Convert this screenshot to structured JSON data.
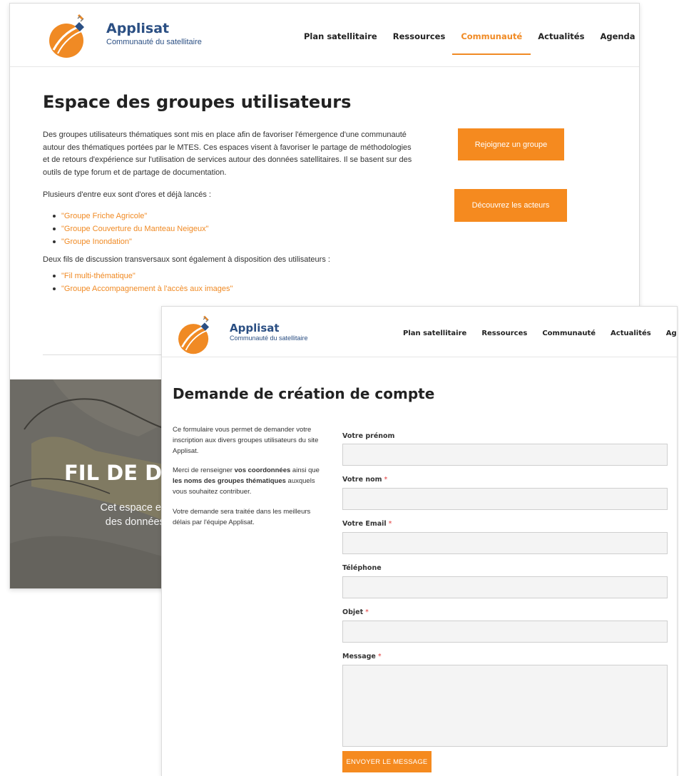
{
  "colors": {
    "accent": "#f08a24",
    "brand": "#2b4f83",
    "button": "#f58a1f",
    "required": "#e23a3a",
    "field_bg": "#f4f4f4",
    "hero_bg": "#6d6b65"
  },
  "site": {
    "name": "Applisat",
    "tagline": "Communauté du satellitaire"
  },
  "nav": {
    "items": [
      "Plan satellitaire",
      "Ressources",
      "Communauté",
      "Actualités",
      "Agenda"
    ],
    "active": "Communauté"
  },
  "groups_page": {
    "title": "Espace des groupes utilisateurs",
    "intro": "Des groupes utilisateurs thématiques sont mis en place afin de favoriser l'émergence d'une communauté autour des thématiques portées par le MTES. Ces espaces visent à favoriser le partage de méthodologies et de retours d'expérience sur l'utilisation de services autour des données satellitaires. Il se basent sur des outils de type forum et de partage de documentation.",
    "launched_text": "Plusieurs d'entre eux sont d'ores et déjà lancés :",
    "groups": [
      "\"Groupe Friche Agricole\"",
      "\"Groupe Couverture du Manteau Neigeux\"",
      "\"Groupe Inondation\""
    ],
    "transverse_text": "Deux fils de discussion transversaux sont également à disposition des utilisateurs :",
    "threads": [
      "\"Fil multi-thématique\"",
      "\"Groupe Accompagnement à l'accès aux images\""
    ],
    "join_button": "Rejoignez un groupe",
    "discover_button": "Découvrez les acteurs",
    "hero": {
      "title": "FIL DE D",
      "line1": "Cet espace est de",
      "line2": "des données sa"
    }
  },
  "account_page": {
    "title": "Demande de création de compte",
    "sidebar": {
      "p1": "Ce formulaire vous permet de demander votre inscription aux divers groupes utilisateurs du site Applisat.",
      "p2_before": "Merci de renseigner ",
      "p2_bold1": "vos coordonnées",
      "p2_mid": " ainsi que ",
      "p2_bold2": "les noms des groupes thématiques",
      "p2_after": " auxquels vous souhaitez contribuer.",
      "p3": "Votre demande sera traitée dans les meilleurs délais par l'équipe Applisat."
    },
    "form": {
      "required_mark": "*",
      "firstname_label": "Votre prénom",
      "lastname_label": "Votre nom",
      "email_label": "Votre Email",
      "phone_label": "Téléphone",
      "subject_label": "Objet",
      "message_label": "Message",
      "submit": "ENVOYER LE MESSAGE"
    }
  }
}
